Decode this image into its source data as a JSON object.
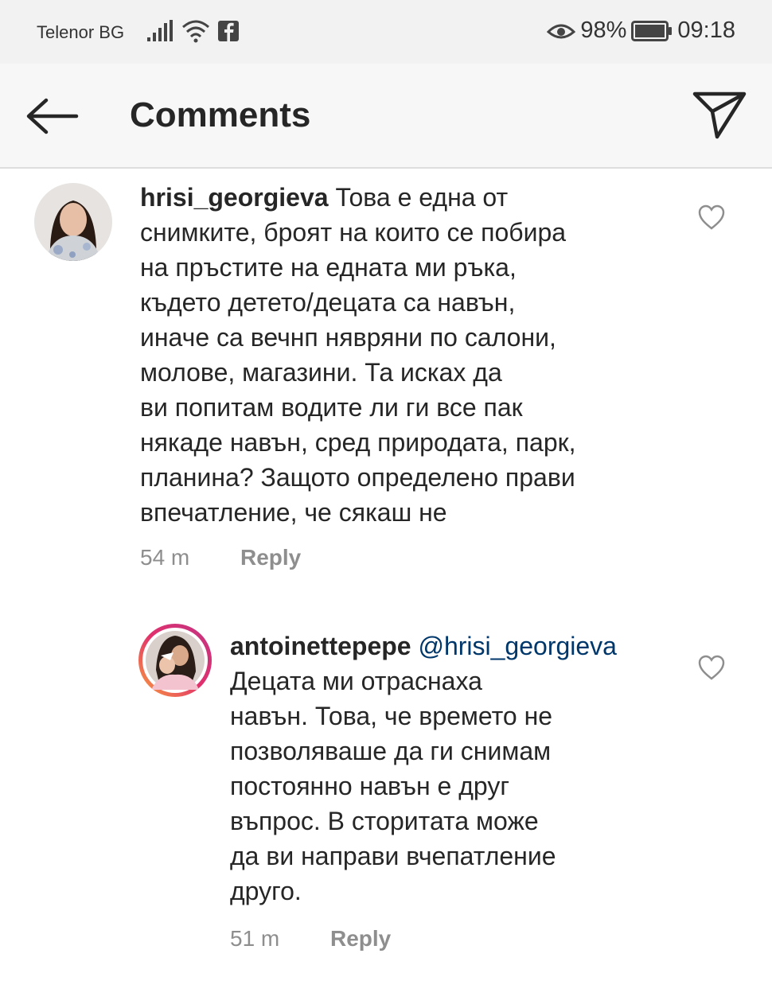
{
  "status_bar": {
    "carrier": "Telenor BG",
    "battery": "98%",
    "time": "09:18",
    "icons": [
      "signal-icon",
      "wifi-icon",
      "facebook-icon",
      "eye-icon",
      "battery-icon"
    ]
  },
  "header": {
    "title": "Comments",
    "back_icon": "arrow-left-icon",
    "send_icon": "paper-plane-icon"
  },
  "comments": [
    {
      "username": "hrisi_georgieva",
      "text": " Това е една от\nснимките, броят на които се побира\nна пръстите на едната ми ръка,\nкъдето детето/децата са навън,\nиначе са вечнп нявряни по салони,\nмолове, магазини. Та исках да\nви попитам водите ли ги все пак\nнякаде навън, сред природата, парк,\nпланина? Защото определено прави\nвпечатление, че сякаш не",
      "time": "54 m",
      "reply_label": "Reply"
    },
    {
      "username": "antoinettepepe",
      "mention": " @hrisi_georgieva",
      "text": "Децата ми отраснаха\nнавън. Това, че времето не\nпозволяваше да ги снимам\nпостоянно навън е друг\nвъпрос. В сторитата може\nда ви направи вчепатление\nдруго.",
      "time": "51 m",
      "reply_label": "Reply"
    }
  ],
  "colors": {
    "status_bar_bg": "#f2f2f2",
    "header_bg": "#f7f7f7",
    "text": "#262626",
    "muted": "#8e8e8e",
    "mention": "#00376b"
  }
}
